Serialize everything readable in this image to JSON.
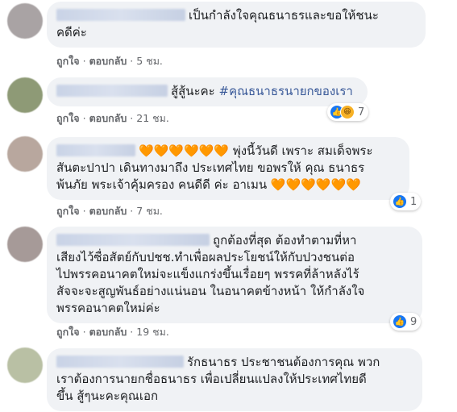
{
  "comments": [
    {
      "text": "เป็นกำลังใจคุณธนาธรและขอให้ชนะคดีค่ะ",
      "line1": "เป็นกำลังใจคุณธนาธรและขอให้ชนะ",
      "line2": "คดีค่ะ",
      "like_label": "ถูกใจ",
      "reply_label": "ตอบกลับ",
      "time": "5 ชม.",
      "avatar_color": "#a9a3a4"
    },
    {
      "text_prefix": "สู้สู้นะคะ",
      "hashtag": "#คุณธนาธรนายกของเรา",
      "like_label": "ถูกใจ",
      "reply_label": "ตอบกลับ",
      "time": "21 ชม.",
      "reaction_count": "7",
      "reaction_icons": [
        "like-icon",
        "haha-icon"
      ],
      "avatar_color": "#8e9a76"
    },
    {
      "line1": "🧡🧡🧡🧡🧡🧡 พุ่งนี้วันดี เพราะ สมเด็จพระ",
      "line2": "สันตะปาปา เดินทางมาถึง ประเทศไทย ขอพรให้ คุณ ธนาธร",
      "line3": "พ้นภัย พระเจ้าคุ้มครอง คนดีดี ค่ะ อาเมน 🧡🧡🧡🧡🧡🧡",
      "like_label": "ถูกใจ",
      "reply_label": "ตอบกลับ",
      "time": "7 ชม.",
      "reaction_count": "1",
      "reaction_icons": [
        "like-icon"
      ],
      "avatar_color": "#b8a79e"
    },
    {
      "line1": "ถูกต้องที่สุด ต้องทำตามที่หา",
      "line2": "เสียงไว้ซื่อสัตย์กับปชช.ทำเพื่อผลประโยชน์ให้กับปวงชนต่อ",
      "line3": "ไปพรรคอนาคตใหม่จะแข็งแกร่งขึ้นเรื่อยๆ พรรคที่ล้าหลังไร้",
      "line4": "สัจจะจะสูญพันธ์อย่างแน่นอน ในอนาคตข้างหน้า ให้กำลังใจ",
      "line5": "พรรคอนาคตใหม่ค่ะ",
      "like_label": "ถูกใจ",
      "reply_label": "ตอบกลับ",
      "time": "19 ชม.",
      "reaction_count": "9",
      "reaction_icons": [
        "like-icon"
      ],
      "avatar_color": "#a69a98"
    },
    {
      "line1": "รักธนาธร ประชาชนต้องการคุณ พวก",
      "line2": "เราต้องการนายกชื่อธนาธร เพื่อเปลี่ยนแปลงให้ประเทศไทยดี",
      "line3": "ขึ้น สู้ๆนะคะคุณเอก",
      "avatar_color": "#b9c0a4"
    }
  ],
  "colors": {
    "bubble": "#f0f2f5",
    "like_blue": "#1877f2",
    "hashtag": "#385898",
    "meta_gray": "#65676b"
  }
}
